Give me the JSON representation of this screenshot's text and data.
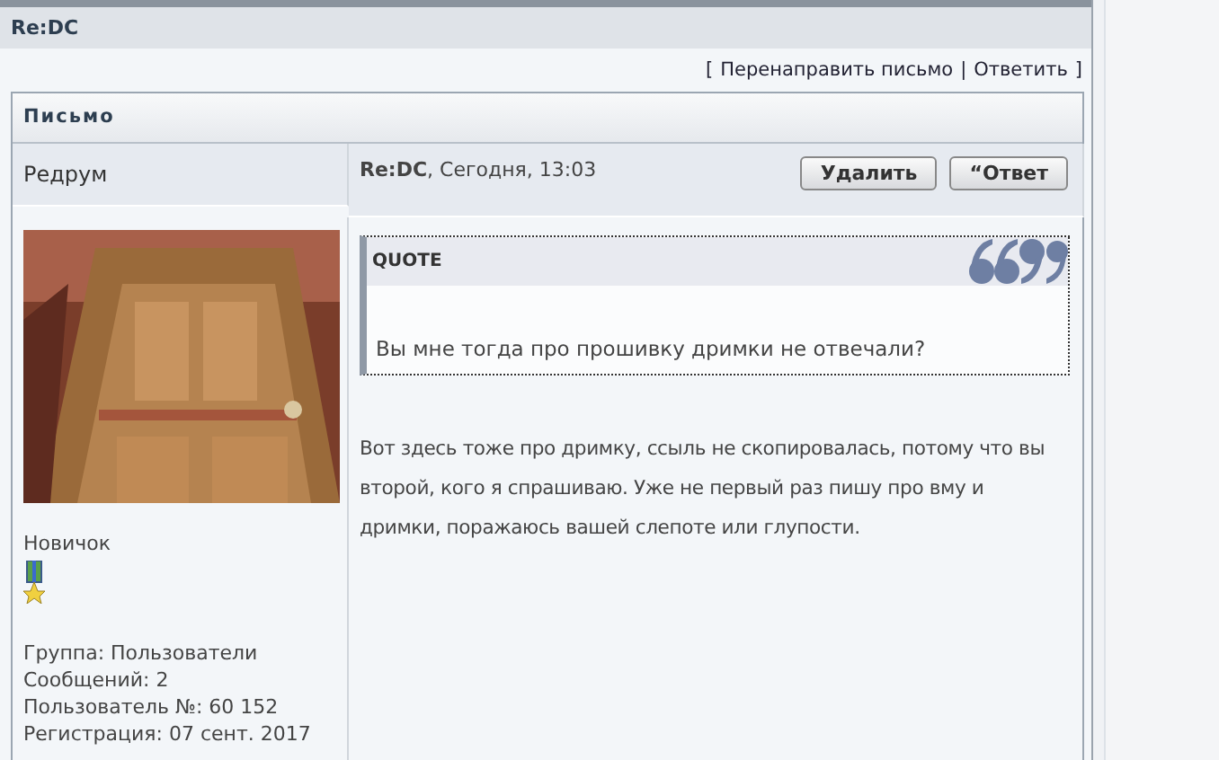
{
  "topic": {
    "title": "Re:DC"
  },
  "actions": {
    "open": "[",
    "separator": "|",
    "close": "]",
    "links": [
      {
        "label": "Перенаправить письмо"
      },
      {
        "label": "Ответить"
      }
    ]
  },
  "letter": {
    "title": "Письмо",
    "author": {
      "name": "Редрум",
      "rank": "Новичок",
      "info": [
        "Группа: Пользователи",
        "Сообщений: 2",
        "Пользователь №: 60 152",
        "Регистрация: 07 сент. 2017"
      ]
    },
    "post": {
      "header": "**Re:DC**, Сегодня, 13:03",
      "buttons": [
        {
          "label": "Удалить"
        },
        {
          "label": "“Ответ"
        }
      ],
      "quote": {
        "title": "QUOTE",
        "text": "Вы мне тогда про прошивку дримки не отвечали?"
      },
      "body": "Вот здесь тоже про дримку, ссыль не скопировалась, потому что вы второй, кого я спрашиваю. Уже не первый раз пишу про вму и дримки, поражаюсь вашей слепоте или глупости."
    }
  }
}
